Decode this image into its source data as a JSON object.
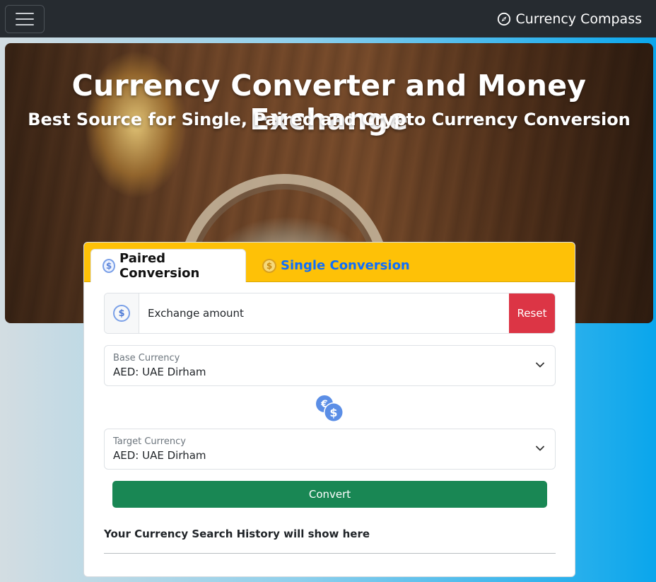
{
  "navbar": {
    "toggler_icon": "hamburger-menu-icon",
    "brand_icon": "compass-icon",
    "brand_label": "Currency Compass"
  },
  "hero": {
    "title": "Currency Converter and Money Exchange",
    "subtitle": "Best Source for Single, Paired and Crypto Currency Conversion"
  },
  "tabs": [
    {
      "label": "Paired Conversion",
      "active": true,
      "icon": "dollar-coin-icon"
    },
    {
      "label": "Single Conversion",
      "active": false,
      "icon": "dollar-coin-icon"
    }
  ],
  "amount": {
    "placeholder": "Exchange amount",
    "value": "",
    "icon": "dollar-coin-icon",
    "reset_label": "Reset"
  },
  "base_currency": {
    "label": "Base Currency",
    "value": "AED: UAE Dirham"
  },
  "target_currency": {
    "label": "Target Currency",
    "value": "AED: UAE Dirham"
  },
  "swap_icon": "euro-dollar-swap-icon",
  "convert_label": "Convert",
  "history_text": "Your Currency Search History will show here",
  "colors": {
    "navbar": "#262b30",
    "tab_bar": "#fec107",
    "reset": "#dc3545",
    "convert": "#198754",
    "link": "#0d6efd"
  }
}
